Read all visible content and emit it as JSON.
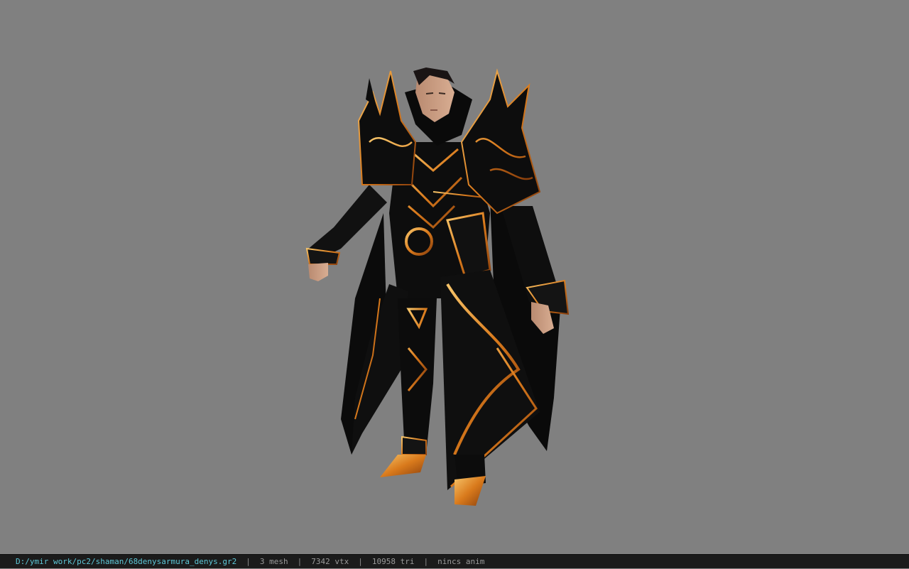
{
  "viewer": {
    "background": "#808080",
    "model_icon": "character-model"
  },
  "status": {
    "file_path": "D:/ymir work/pc2/shaman/68denysarmura_denys.gr2",
    "separator": "|",
    "mesh_count": "3 mesh",
    "vertex_count": "7342 vtx",
    "triangle_count": "10958 tri",
    "anim_status": "nincs anim"
  },
  "colors": {
    "path_text": "#5ec8d8",
    "info_text": "#9a9a9a",
    "armor_gold": "#e08a2a",
    "armor_black": "#0d0d0d"
  }
}
